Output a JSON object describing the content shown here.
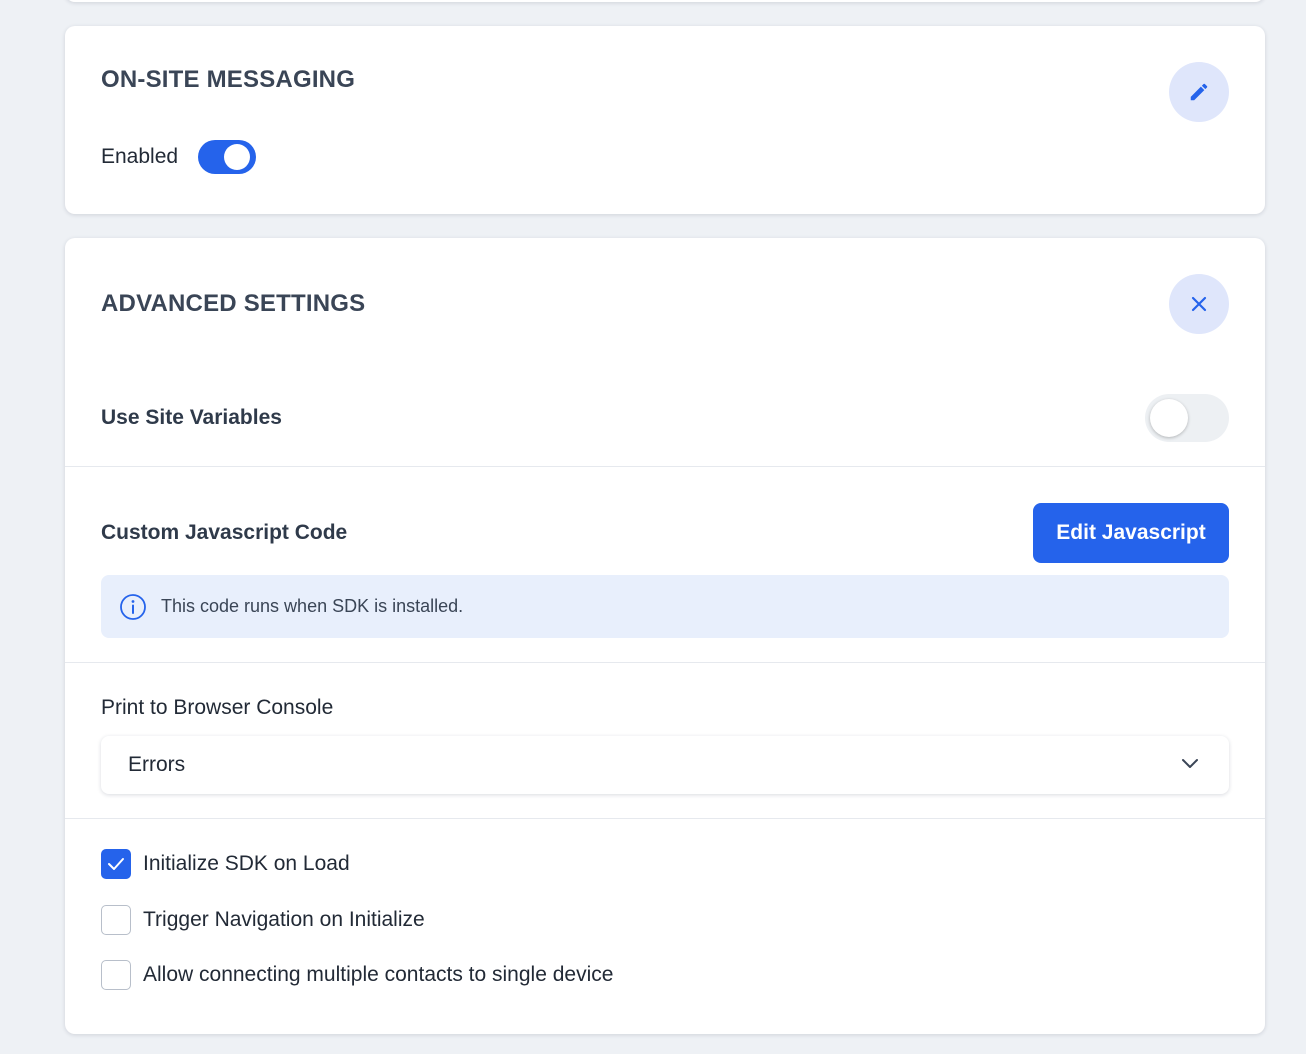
{
  "onsite": {
    "title": "ON-SITE MESSAGING",
    "edit_icon": "pencil-icon",
    "enabled_label": "Enabled",
    "enabled": true
  },
  "advanced": {
    "title": "ADVANCED SETTINGS",
    "close_icon": "close-icon",
    "site_variables": {
      "label": "Use Site Variables",
      "enabled": false
    },
    "custom_js": {
      "label": "Custom Javascript Code",
      "button_label": "Edit Javascript",
      "info_icon": "info-icon",
      "info_text": "This code runs when SDK is installed."
    },
    "console": {
      "label": "Print to Browser Console",
      "selected": "Errors",
      "chevron_icon": "chevron-down-icon"
    },
    "checkboxes": [
      {
        "label": "Initialize SDK on Load",
        "checked": true
      },
      {
        "label": "Trigger Navigation on Initialize",
        "checked": false
      },
      {
        "label": "Allow connecting multiple contacts to single device",
        "checked": false
      }
    ]
  },
  "colors": {
    "accent": "#2563eb",
    "round_button_bg": "#dfe6fb",
    "info_bg": "#e8effc",
    "page_bg": "#eef1f5"
  }
}
